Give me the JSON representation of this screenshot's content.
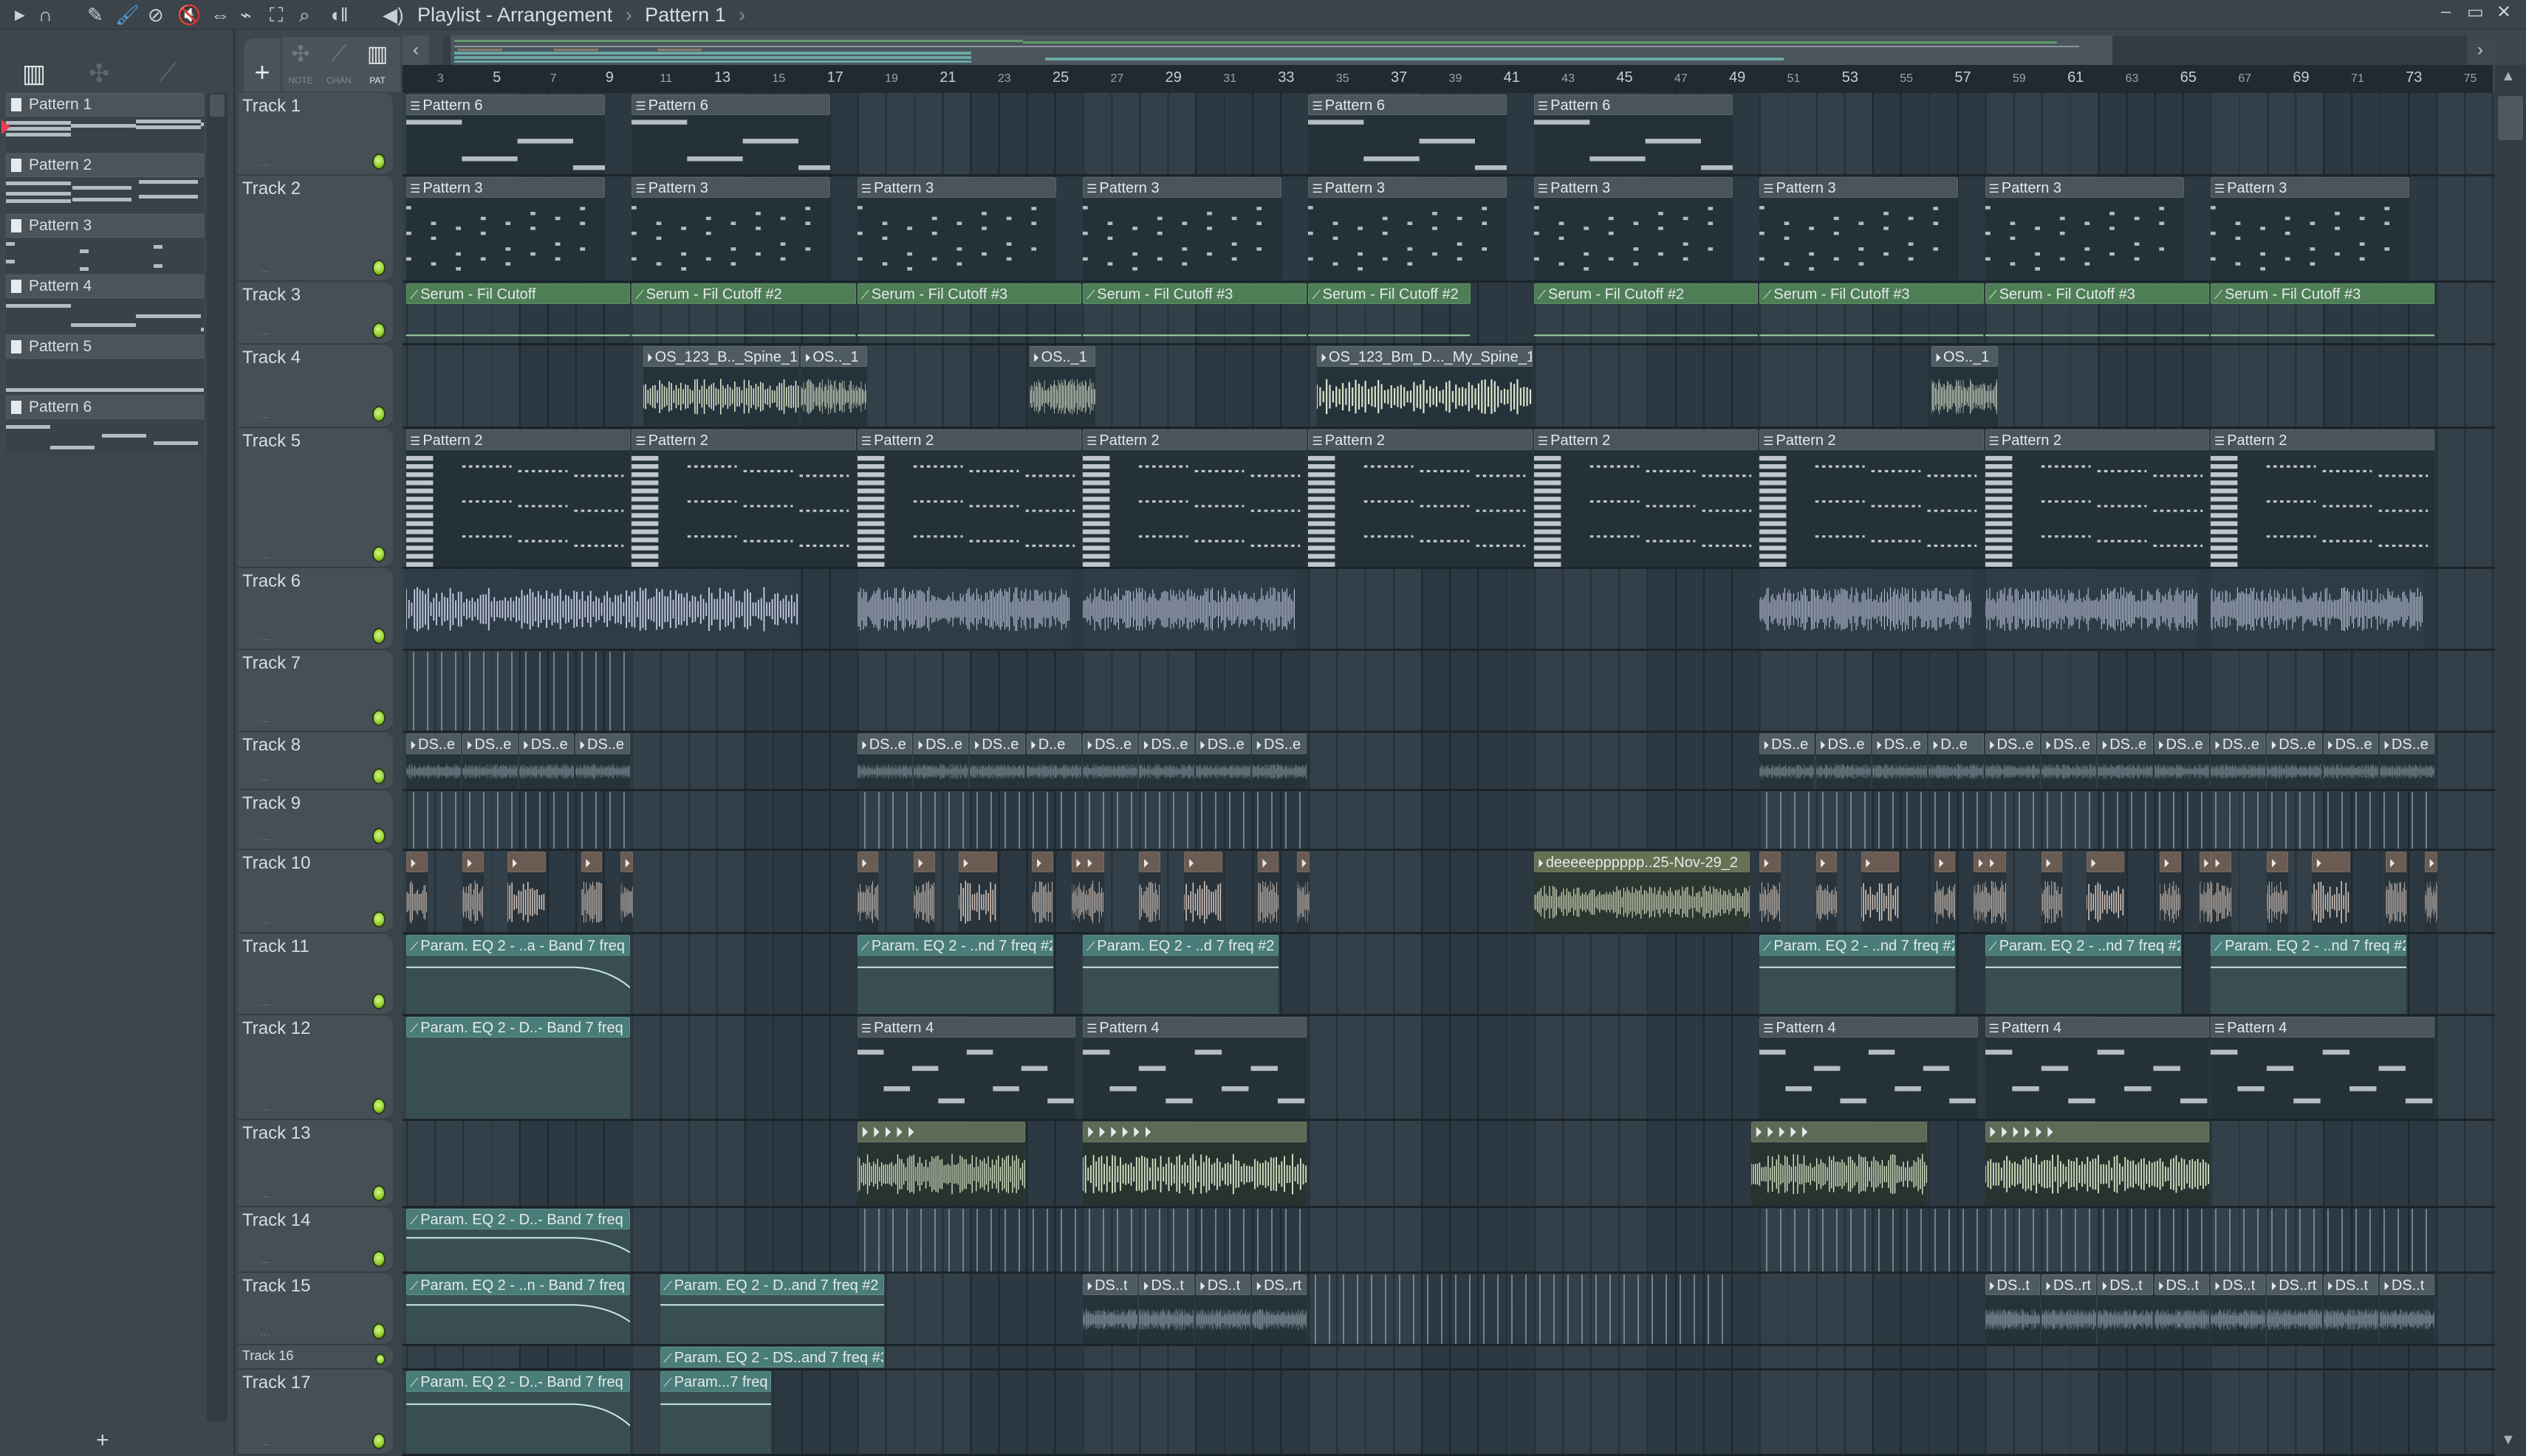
{
  "window": {
    "title": "Playlist - Arrangement",
    "pattern": "Pattern 1",
    "separator": "›",
    "minimize": "–",
    "maximize": "▭",
    "close": "✕"
  },
  "toolbar": {
    "icons": [
      "play-arrow-icon",
      "magnet-snap-icon",
      "pencil-icon",
      "paint-brush-icon",
      "delete-icon",
      "mute-icon",
      "slip-icon",
      "slice-icon",
      "select-icon",
      "zoom-icon",
      "playback-icon",
      "speaker-icon"
    ],
    "active": "paint-brush-icon",
    "accent": "#4fa3e6"
  },
  "modes": {
    "note": "NOTE",
    "chan": "CHAN",
    "pat": "PAT",
    "add": "+",
    "active": "PAT"
  },
  "left_panel": {
    "patterns": [
      "Pattern 1",
      "Pattern 2",
      "Pattern 3",
      "Pattern 4",
      "Pattern 5",
      "Pattern 6"
    ],
    "selected": "Pattern 1",
    "add": "+"
  },
  "ruler": {
    "bars": [
      3,
      5,
      7,
      9,
      11,
      13,
      15,
      17,
      19,
      21,
      23,
      25,
      27,
      29,
      31,
      33,
      35,
      37,
      39,
      41,
      43,
      45,
      47,
      49,
      51,
      53,
      55,
      57,
      59,
      61,
      63,
      65,
      67,
      69,
      71,
      73,
      75
    ]
  },
  "colors": {
    "led": "#8fcf2a",
    "automation": "#4e7e55",
    "param": "#4a7d79",
    "pattern": "#4a545b"
  },
  "tracks": [
    {
      "name": "Track 1",
      "clips": [
        {
          "type": "pattern",
          "label": "Pattern 6",
          "start": 1,
          "len": 7.1
        },
        {
          "type": "pattern",
          "label": "Pattern 6",
          "start": 9,
          "len": 7.1
        },
        {
          "type": "pattern",
          "label": "Pattern 6",
          "start": 33,
          "len": 7.1
        },
        {
          "type": "pattern",
          "label": "Pattern 6",
          "start": 41,
          "len": 7.1
        }
      ]
    },
    {
      "name": "Track 2",
      "clips": [
        {
          "type": "pattern",
          "label": "Pattern 3",
          "start": 1,
          "len": 7.1
        },
        {
          "type": "pattern",
          "label": "Pattern 3",
          "start": 9,
          "len": 7.1
        },
        {
          "type": "pattern",
          "label": "Pattern 3",
          "start": 17,
          "len": 7.1
        },
        {
          "type": "pattern",
          "label": "Pattern 3",
          "start": 25,
          "len": 7.1
        },
        {
          "type": "pattern",
          "label": "Pattern 3",
          "start": 33,
          "len": 7.1
        },
        {
          "type": "pattern",
          "label": "Pattern 3",
          "start": 41,
          "len": 7.1
        },
        {
          "type": "pattern",
          "label": "Pattern 3",
          "start": 49,
          "len": 7.1
        },
        {
          "type": "pattern",
          "label": "Pattern 3",
          "start": 57,
          "len": 7.1
        },
        {
          "type": "pattern",
          "label": "Pattern 3",
          "start": 65,
          "len": 7.1
        }
      ]
    },
    {
      "name": "Track 3",
      "clips": [
        {
          "type": "auto",
          "label": "Serum - Fil Cutoff",
          "start": 1,
          "len": 8
        },
        {
          "type": "auto",
          "label": "Serum - Fil Cutoff #2",
          "start": 9,
          "len": 8
        },
        {
          "type": "auto",
          "label": "Serum - Fil Cutoff #3",
          "start": 17,
          "len": 8
        },
        {
          "type": "auto",
          "label": "Serum - Fil Cutoff #3",
          "start": 25,
          "len": 8
        },
        {
          "type": "auto",
          "label": "Serum - Fil Cutoff #2",
          "start": 33,
          "len": 5.8
        },
        {
          "type": "auto",
          "label": "Serum - Fil Cutoff #2",
          "start": 41,
          "len": 8
        },
        {
          "type": "auto",
          "label": "Serum - Fil Cutoff #3",
          "start": 49,
          "len": 8
        },
        {
          "type": "auto",
          "label": "Serum - Fil Cutoff #3",
          "start": 57,
          "len": 8
        },
        {
          "type": "auto",
          "label": "Serum - Fil Cutoff #3",
          "start": 65,
          "len": 8
        }
      ]
    },
    {
      "name": "Track 4",
      "clips": [
        {
          "type": "audio",
          "label": "OS_123_B.._Spine_1",
          "start": 9.4,
          "len": 5.6
        },
        {
          "type": "audio",
          "label": "OS.._1",
          "start": 15,
          "len": 2.4
        },
        {
          "type": "audio",
          "label": "OS.._1",
          "start": 23.1,
          "len": 2.4
        },
        {
          "type": "audio",
          "label": "OS_123_Bm_D..._My_Spine_1",
          "start": 33.3,
          "len": 7.7
        },
        {
          "type": "audio",
          "label": "OS.._1",
          "start": 55.1,
          "len": 2.4
        }
      ]
    },
    {
      "name": "Track 5",
      "clips": [
        {
          "type": "pattern",
          "label": "Pattern 2",
          "start": 1,
          "len": 8
        },
        {
          "type": "pattern",
          "label": "Pattern 2",
          "start": 9,
          "len": 8
        },
        {
          "type": "pattern",
          "label": "Pattern 2",
          "start": 17,
          "len": 8
        },
        {
          "type": "pattern",
          "label": "Pattern 2",
          "start": 25,
          "len": 8
        },
        {
          "type": "pattern",
          "label": "Pattern 2",
          "start": 33,
          "len": 8
        },
        {
          "type": "pattern",
          "label": "Pattern 2",
          "start": 41,
          "len": 8
        },
        {
          "type": "pattern",
          "label": "Pattern 2",
          "start": 49,
          "len": 8
        },
        {
          "type": "pattern",
          "label": "Pattern 2",
          "start": 57,
          "len": 8
        },
        {
          "type": "pattern",
          "label": "Pattern 2",
          "start": 65,
          "len": 8
        }
      ]
    },
    {
      "name": "Track 6",
      "clips": [
        {
          "type": "wave",
          "start": 1,
          "len": 14
        },
        {
          "type": "wave",
          "start": 17,
          "len": 7.6
        },
        {
          "type": "wave",
          "start": 25,
          "len": 7.6
        },
        {
          "type": "wave",
          "start": 49,
          "len": 7.6
        },
        {
          "type": "wave",
          "start": 57,
          "len": 7.6
        },
        {
          "type": "wave",
          "start": 65,
          "len": 7.6
        }
      ]
    },
    {
      "name": "Track 7",
      "clips": [
        {
          "type": "ticks",
          "start": 1,
          "len": 8
        }
      ]
    },
    {
      "name": "Track 8",
      "clips": [
        {
          "type": "audio",
          "label": "DS..e",
          "start": 1,
          "len": 2
        },
        {
          "type": "audio",
          "label": "DS..e",
          "start": 3,
          "len": 2
        },
        {
          "type": "audio",
          "label": "DS..e",
          "start": 5,
          "len": 2
        },
        {
          "type": "audio",
          "label": "DS..e",
          "start": 7,
          "len": 2
        },
        {
          "type": "audio",
          "label": "DS..e",
          "start": 17,
          "len": 2
        },
        {
          "type": "audio",
          "label": "DS..e",
          "start": 19,
          "len": 2
        },
        {
          "type": "audio",
          "label": "DS..e",
          "start": 21,
          "len": 2
        },
        {
          "type": "audio",
          "label": "D..e",
          "start": 23,
          "len": 2
        },
        {
          "type": "audio",
          "label": "DS..e",
          "start": 25,
          "len": 2
        },
        {
          "type": "audio",
          "label": "DS..e",
          "start": 27,
          "len": 2
        },
        {
          "type": "audio",
          "label": "DS..e",
          "start": 29,
          "len": 2
        },
        {
          "type": "audio",
          "label": "DS..e",
          "start": 31,
          "len": 2
        },
        {
          "type": "audio",
          "label": "DS..e",
          "start": 49,
          "len": 2
        },
        {
          "type": "audio",
          "label": "DS..e",
          "start": 51,
          "len": 2
        },
        {
          "type": "audio",
          "label": "DS..e",
          "start": 53,
          "len": 2
        },
        {
          "type": "audio",
          "label": "D..e",
          "start": 55,
          "len": 2
        },
        {
          "type": "audio",
          "label": "DS..e",
          "start": 57,
          "len": 2
        },
        {
          "type": "audio",
          "label": "DS..e",
          "start": 59,
          "len": 2
        },
        {
          "type": "audio",
          "label": "DS..e",
          "start": 61,
          "len": 2
        },
        {
          "type": "audio",
          "label": "DS..e",
          "start": 63,
          "len": 2
        },
        {
          "type": "audio",
          "label": "DS..e",
          "start": 65,
          "len": 2
        },
        {
          "type": "audio",
          "label": "DS..e",
          "start": 67,
          "len": 2
        },
        {
          "type": "audio",
          "label": "DS..e",
          "start": 69,
          "len": 2
        },
        {
          "type": "audio",
          "label": "DS..e",
          "start": 71,
          "len": 2
        }
      ]
    },
    {
      "name": "Track 9",
      "clips": [
        {
          "type": "ticks",
          "start": 1,
          "len": 8
        },
        {
          "type": "ticks",
          "start": 17,
          "len": 16
        },
        {
          "type": "ticks",
          "start": 49,
          "len": 24
        }
      ]
    },
    {
      "name": "Track 10",
      "hit_groups": [
        1,
        17,
        25,
        49,
        57,
        65
      ],
      "hit_pattern": [
        [
          0,
          0.8
        ],
        [
          2,
          0.8
        ],
        [
          3.6,
          1.4
        ],
        [
          6.2,
          0.8
        ],
        [
          7.6,
          0.5
        ]
      ],
      "clips": [
        {
          "type": "big",
          "label": "deeeeepppppp..25-Nov-29_2",
          "start": 41,
          "len": 7.7
        }
      ]
    },
    {
      "name": "Track 11",
      "clips": [
        {
          "type": "param",
          "label": "Param. EQ 2 - ..a - Band 7 freq",
          "start": 1,
          "len": 8,
          "curve": "drop"
        },
        {
          "type": "param",
          "label": "Param. EQ 2 - ..nd 7 freq #2",
          "start": 17,
          "len": 7,
          "curve": "flat"
        },
        {
          "type": "param",
          "label": "Param. EQ 2 - ..d 7 freq #2",
          "start": 25,
          "len": 7,
          "curve": "flat"
        },
        {
          "type": "param",
          "label": "Param. EQ 2 - ..nd 7 freq #2",
          "start": 49,
          "len": 7,
          "curve": "flat"
        },
        {
          "type": "param",
          "label": "Param. EQ 2 - ..nd 7 freq #2",
          "start": 57,
          "len": 7,
          "curve": "flat"
        },
        {
          "type": "param",
          "label": "Param. EQ 2 - ..nd 7 freq #2",
          "start": 65,
          "len": 7,
          "curve": "flat"
        }
      ]
    },
    {
      "name": "Track 12",
      "clips": [
        {
          "type": "param",
          "label": "Param. EQ 2 - D..- Band 7 freq",
          "start": 1,
          "len": 8,
          "curve": "none"
        },
        {
          "type": "pattern",
          "label": "Pattern 4",
          "start": 17,
          "len": 7.8
        },
        {
          "type": "pattern",
          "label": "Pattern 4",
          "start": 25,
          "len": 8
        },
        {
          "type": "pattern",
          "label": "Pattern 4",
          "start": 49,
          "len": 7.8
        },
        {
          "type": "pattern",
          "label": "Pattern 4",
          "start": 57,
          "len": 8
        },
        {
          "type": "pattern",
          "label": "Pattern 4",
          "start": 65,
          "len": 8
        }
      ]
    },
    {
      "name": "Track 13",
      "clips": [
        {
          "type": "grn",
          "label": "⏵ ⏵ ⏵ ⏵ ⏵",
          "start": 17,
          "len": 6
        },
        {
          "type": "grn",
          "label": "⏵ ⏵ ⏵ ⏵ ⏵ ⏵",
          "start": 25,
          "len": 8
        },
        {
          "type": "grn",
          "label": "⏵ ⏵ ⏵ ⏵ ⏵",
          "start": 48.7,
          "len": 6.3
        },
        {
          "type": "grn",
          "label": "⏵ ⏵ ⏵ ⏵ ⏵ ⏵",
          "start": 57,
          "len": 8
        }
      ]
    },
    {
      "name": "Track 14",
      "clips": [
        {
          "type": "param",
          "label": "Param. EQ 2 - D..- Band 7 freq",
          "start": 1,
          "len": 8,
          "curve": "drop"
        },
        {
          "type": "ticks",
          "start": 17,
          "len": 16
        },
        {
          "type": "ticks",
          "start": 49,
          "len": 24
        }
      ]
    },
    {
      "name": "Track 15",
      "clips": [
        {
          "type": "param",
          "label": "Param. EQ 2 - ..n - Band 7 freq",
          "start": 1,
          "len": 8,
          "curve": "drop"
        },
        {
          "type": "param",
          "label": "Param. EQ 2 - D..and 7 freq #2",
          "start": 10,
          "len": 8,
          "curve": "flat"
        },
        {
          "type": "audio",
          "label": "DS..t",
          "start": 25,
          "len": 2
        },
        {
          "type": "audio",
          "label": "DS..t",
          "start": 27,
          "len": 2
        },
        {
          "type": "audio",
          "label": "DS..t",
          "start": 29,
          "len": 2
        },
        {
          "type": "audio",
          "label": "DS..rt",
          "start": 31,
          "len": 2
        },
        {
          "type": "ticks",
          "start": 33,
          "len": 15
        },
        {
          "type": "audio",
          "label": "DS..t",
          "start": 57,
          "len": 2
        },
        {
          "type": "audio",
          "label": "DS..rt",
          "start": 59,
          "len": 2
        },
        {
          "type": "audio",
          "label": "DS..t",
          "start": 61,
          "len": 2
        },
        {
          "type": "audio",
          "label": "DS..t",
          "start": 63,
          "len": 2
        },
        {
          "type": "audio",
          "label": "DS..t",
          "start": 65,
          "len": 2
        },
        {
          "type": "audio",
          "label": "DS..rt",
          "start": 67,
          "len": 2
        },
        {
          "type": "audio",
          "label": "DS..t",
          "start": 69,
          "len": 2
        },
        {
          "type": "audio",
          "label": "DS..t",
          "start": 71,
          "len": 2
        }
      ]
    },
    {
      "name": "Track 16",
      "clips": [
        {
          "type": "param",
          "label": "Param. EQ 2 - DS..and 7 freq #3",
          "start": 10,
          "len": 8,
          "curve": "none"
        }
      ]
    },
    {
      "name": "Track 17",
      "clips": [
        {
          "type": "param",
          "label": "Param. EQ 2 - D..- Band 7 freq",
          "start": 1,
          "len": 8,
          "curve": "drop"
        },
        {
          "type": "param",
          "label": "Param...7 freq",
          "start": 10,
          "len": 4,
          "curve": "flat"
        }
      ]
    }
  ]
}
